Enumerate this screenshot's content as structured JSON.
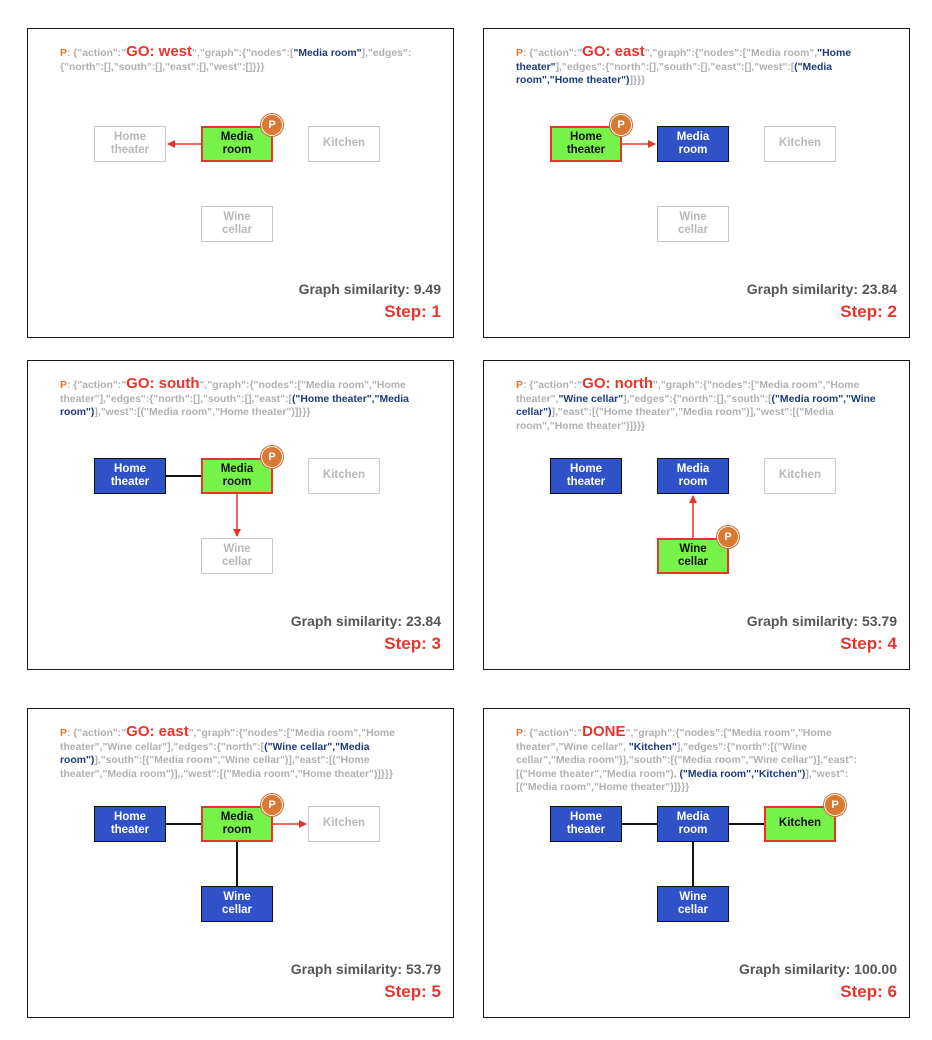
{
  "colors": {
    "current_fill": "#76f249",
    "current_border": "#e8352b",
    "known_fill": "#2f52c9",
    "unknown_border": "#c8c8c8",
    "edge": "#111111",
    "arrow": "#e8352b",
    "badge": "#d97a34",
    "action_text": "#e8352b",
    "new_item_text": "#1f3a7a",
    "similarity_text": "#555555"
  },
  "player_badge_label": "P",
  "node_labels": {
    "media_room": "Media\nroom",
    "home_theater": "Home\ntheater",
    "kitchen": "Kitchen",
    "wine_cellar": "Wine\ncellar"
  },
  "panels": [
    {
      "header": [
        {
          "t": "P",
          "c": "orange"
        },
        {
          "t": ": {\"action\":\"",
          "c": ""
        },
        {
          "t": "GO: west",
          "c": "red"
        },
        {
          "t": "\",\"graph\":{\"nodes\":[",
          "c": ""
        },
        {
          "t": "\"Media room\"",
          "c": "blue"
        },
        {
          "t": "],\"edges\":{\"north\":[],\"south\":[],\"east\":[],\"west\":[]}}}",
          "c": ""
        }
      ],
      "nodes": {
        "media_room": "current",
        "home_theater": "unknown",
        "kitchen": "unknown",
        "wine_cellar": "unknown"
      },
      "player": "media_room",
      "edges": [],
      "arrow": {
        "from": "media_room",
        "to": "home_theater"
      },
      "similarity_label": "Graph similarity:",
      "similarity": "9.49",
      "step_label": "Step:",
      "step": "1"
    },
    {
      "header": [
        {
          "t": "P",
          "c": "orange"
        },
        {
          "t": ": {\"action\":\"",
          "c": ""
        },
        {
          "t": "GO: east",
          "c": "red"
        },
        {
          "t": "\",\"graph\":{\"nodes\":[\"Media room\",",
          "c": ""
        },
        {
          "t": "\"Home theater\"",
          "c": "blue"
        },
        {
          "t": "],\"edges\":{\"north\":[],\"south\":[],\"east\":[],\"west\":[",
          "c": ""
        },
        {
          "t": "(\"Media room\",\"Home theater\")",
          "c": "blue"
        },
        {
          "t": "]}}}",
          "c": ""
        }
      ],
      "nodes": {
        "media_room": "known",
        "home_theater": "current",
        "kitchen": "unknown",
        "wine_cellar": "unknown"
      },
      "player": "home_theater",
      "edges": [],
      "arrow": {
        "from": "home_theater",
        "to": "media_room"
      },
      "similarity_label": "Graph similarity:",
      "similarity": "23.84",
      "step_label": "Step:",
      "step": "2"
    },
    {
      "header": [
        {
          "t": "P",
          "c": "orange"
        },
        {
          "t": ": {\"action\":\"",
          "c": ""
        },
        {
          "t": "GO: south",
          "c": "red"
        },
        {
          "t": "\",\"graph\":{\"nodes\":[\"Media room\",\"Home theater\"],\"edges\":{\"north\":[],\"south\":[],\"east\":[",
          "c": ""
        },
        {
          "t": "(\"Home theater\",\"Media room\")",
          "c": "blue"
        },
        {
          "t": "],\"west\":[(\"Media room\",\"Home theater\")]}}}",
          "c": ""
        }
      ],
      "nodes": {
        "media_room": "current",
        "home_theater": "known",
        "kitchen": "unknown",
        "wine_cellar": "unknown"
      },
      "player": "media_room",
      "edges": [
        [
          "home_theater",
          "media_room"
        ]
      ],
      "arrow": {
        "from": "media_room",
        "to": "wine_cellar"
      },
      "similarity_label": "Graph similarity:",
      "similarity": "23.84",
      "step_label": "Step:",
      "step": "3"
    },
    {
      "header": [
        {
          "t": "P",
          "c": "orange"
        },
        {
          "t": ": {\"action\":\"",
          "c": ""
        },
        {
          "t": "GO: north",
          "c": "red"
        },
        {
          "t": "\",\"graph\":{\"nodes\":[\"Media room\",\"Home theater\",",
          "c": ""
        },
        {
          "t": "\"Wine cellar\"",
          "c": "blue"
        },
        {
          "t": "],\"edges\":{\"north\":[],\"south\":[",
          "c": ""
        },
        {
          "t": "(\"Media room\",\"Wine cellar\")",
          "c": "blue"
        },
        {
          "t": "],\"east\":[(\"Home theater\",\"Media room\")],\"west\":[(\"Media room\",\"Home theater\")]}}}",
          "c": ""
        }
      ],
      "nodes": {
        "media_room": "known",
        "home_theater": "known",
        "kitchen": "unknown",
        "wine_cellar": "current"
      },
      "player": "wine_cellar",
      "edges": [],
      "arrow": {
        "from": "wine_cellar",
        "to": "media_room"
      },
      "similarity_label": "Graph similarity:",
      "similarity": "53.79",
      "step_label": "Step:",
      "step": "4"
    },
    {
      "header": [
        {
          "t": "P",
          "c": "orange"
        },
        {
          "t": ":  {\"action\":\"",
          "c": ""
        },
        {
          "t": "GO: east",
          "c": "red"
        },
        {
          "t": "\",\"graph\":{\"nodes\":[\"Media room\",\"Home theater\",\"Wine cellar\"],\"edges\":{\"north\":[",
          "c": ""
        },
        {
          "t": "(\"Wine cellar\",\"Media room\")",
          "c": "blue"
        },
        {
          "t": "],\"south\":[(\"Media room\",\"Wine cellar\")],\"east\":[(\"Home theater\",\"Media room\")],,\"west\":[(\"Media room\",\"Home theater\")]}}}",
          "c": ""
        }
      ],
      "nodes": {
        "media_room": "current",
        "home_theater": "known",
        "kitchen": "unknown",
        "wine_cellar": "known"
      },
      "player": "media_room",
      "edges": [
        [
          "home_theater",
          "media_room"
        ],
        [
          "media_room",
          "wine_cellar"
        ]
      ],
      "arrow": {
        "from": "media_room",
        "to": "kitchen"
      },
      "similarity_label": "Graph similarity:",
      "similarity": "53.79",
      "step_label": "Step:",
      "step": "5"
    },
    {
      "header": [
        {
          "t": "P",
          "c": "orange"
        },
        {
          "t": ":  {\"action\":\"",
          "c": ""
        },
        {
          "t": "DONE",
          "c": "red"
        },
        {
          "t": "\",\"graph\":{\"nodes\":[\"Media room\",\"Home theater\",\"Wine cellar\", ",
          "c": ""
        },
        {
          "t": "\"Kitchen\"",
          "c": "blue"
        },
        {
          "t": "],\"edges\":{\"north\":[(\"Wine cellar\",\"Media room\")],\"south\":[(\"Media room\",\"Wine cellar\")],\"east\":[(\"Home theater\",\"Media room\"), ",
          "c": ""
        },
        {
          "t": "(\"Media room\",\"Kitchen\")",
          "c": "blue"
        },
        {
          "t": "],\"west\":[(\"Media room\",\"Home theater\")]}}}",
          "c": ""
        }
      ],
      "nodes": {
        "media_room": "known",
        "home_theater": "known",
        "kitchen": "current",
        "wine_cellar": "known"
      },
      "player": "kitchen",
      "edges": [
        [
          "home_theater",
          "media_room"
        ],
        [
          "media_room",
          "kitchen"
        ],
        [
          "media_room",
          "wine_cellar"
        ]
      ],
      "arrow": null,
      "similarity_label": "Graph similarity:",
      "similarity": "100.00",
      "step_label": "Step:",
      "step": "6"
    }
  ]
}
